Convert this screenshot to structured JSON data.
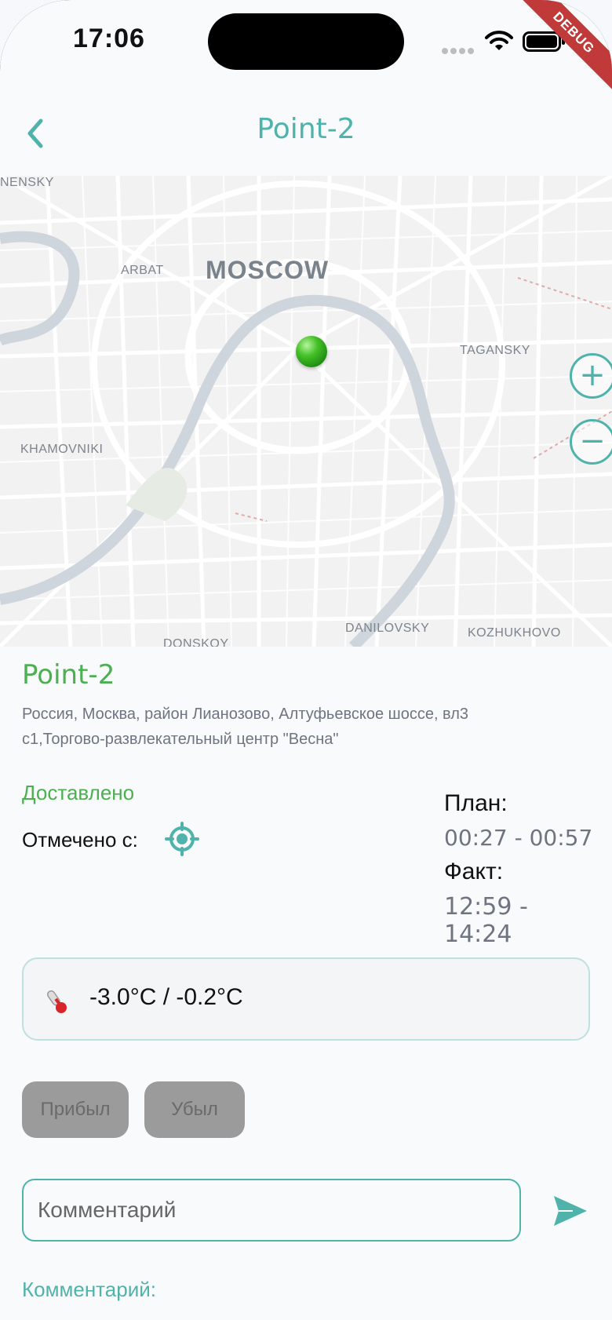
{
  "status_bar": {
    "time": "17:06",
    "debug_label": "DEBUG"
  },
  "app_bar": {
    "title": "Point-2",
    "back_icon": "chevron-left-icon"
  },
  "map": {
    "labels": {
      "city": "MOSCOW",
      "arbat": "ARBAT",
      "taganksy": "TAGANSKY",
      "khamovniki": "KHAMOVNIKI",
      "danilovsky": "DANILOVSKY",
      "kozhukhovo": "KOZHUKHOVO",
      "donskoy": "DONSKOY",
      "presnensky": "NENSKY"
    },
    "zoom_in": "+",
    "zoom_out": "−",
    "pin_color": "#3cb521"
  },
  "point": {
    "name": "Point-2",
    "address": "Россия, Москва, район Лианозово, Алтуфьевское шоссе, вл3 с1,Торгово-развлекательный центр \"Весна\""
  },
  "status": {
    "delivered": "Доставлено",
    "marked_from": "Отмечено с:",
    "marked_icon": "gps-target-icon"
  },
  "times": {
    "plan_label": "План:",
    "plan_value": "00:27 - 00:57",
    "fact_label": "Факт:",
    "fact_value": "12:59 - 14:24"
  },
  "temperature": {
    "icon": "thermometer-icon",
    "value": "-3.0°C / -0.2°C"
  },
  "actions": {
    "arrived": "Прибыл",
    "left": "Убыл"
  },
  "comment": {
    "placeholder": "Комментарий",
    "send_icon": "send-icon",
    "section_label": "Комментарий:"
  },
  "colors": {
    "accent": "#4fb3ac",
    "success": "#4caf50",
    "disabled_button": "#9b9b9b"
  }
}
